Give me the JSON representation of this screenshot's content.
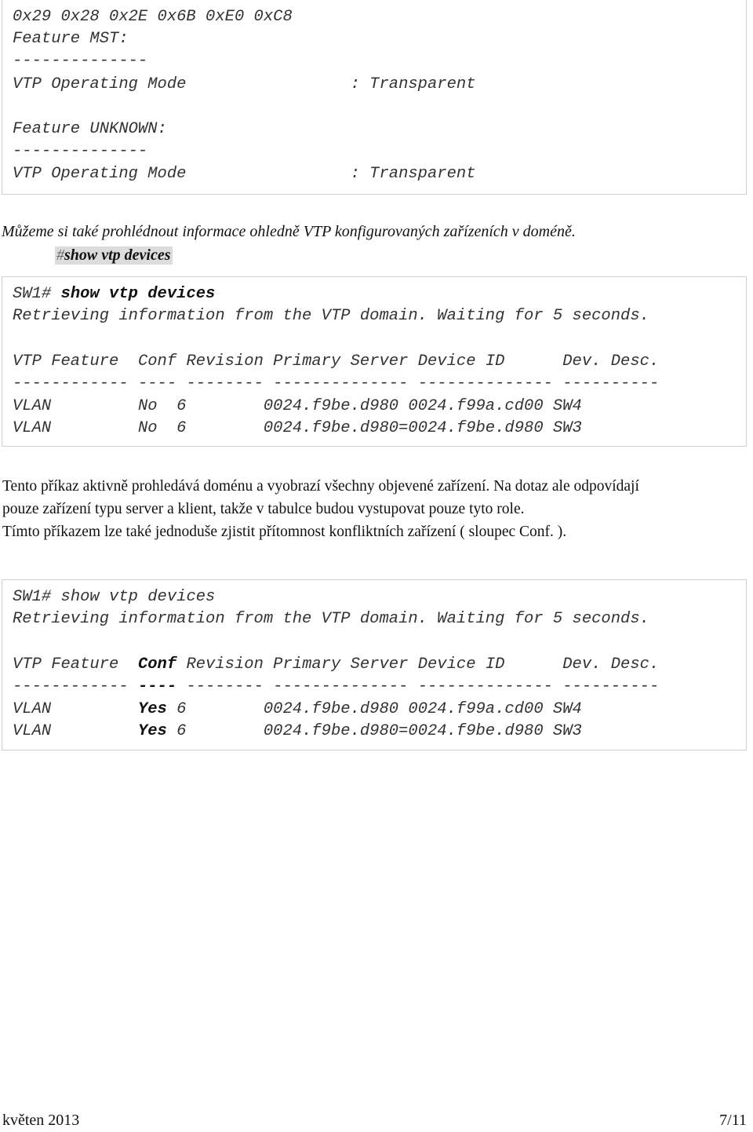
{
  "box1": {
    "lines": [
      "0x29 0x28 0x2E 0x6B 0xE0 0xC8",
      "Feature MST:",
      "--------------",
      "VTP Operating Mode                 : Transparent",
      "",
      "Feature UNKNOWN:",
      "--------------",
      "VTP Operating Mode                 : Transparent"
    ]
  },
  "intro_text": "Můžeme si také prohlédnout informace ohledně VTP konfigurovaných zařízeních v doméně.",
  "command": {
    "hash": "#",
    "text": "show vtp devices"
  },
  "box2": {
    "prompt": "SW1# ",
    "command": "show vtp devices",
    "retrieving": "Retrieving information from the VTP domain. Waiting for 5 seconds.",
    "header": {
      "feature": "VTP Feature  ",
      "conf": "Conf",
      "rest": " Revision Primary Server Device ID      Dev. Desc."
    },
    "separator": {
      "a": "------------ ",
      "b": "----",
      "c": " -------- -------------- -------------- ----------"
    },
    "rows": [
      {
        "feature": "VLAN         ",
        "conf": "No ",
        "rest": " 6        0024.f9be.d980 0024.f99a.cd00 SW4"
      },
      {
        "feature": "VLAN         ",
        "conf": "No ",
        "rest": " 6        0024.f9be.d980=0024.f9be.d980 SW3"
      }
    ]
  },
  "paragraph": [
    "Tento příkaz aktivně prohledává doménu a vyobrazí všechny objevené zařízení. Na dotaz ale odpovídají",
    "pouze zařízení typu server a klient, takže v tabulce budou vystupovat pouze tyto role.",
    "Tímto příkazem lze také jednoduše zjistit přítomnost konfliktních zařízení ( sloupec Conf. )."
  ],
  "box3": {
    "prompt": "SW1# ",
    "command": "show vtp devices",
    "retrieving": "Retrieving information from the VTP domain. Waiting for 5 seconds.",
    "header": {
      "feature": "VTP Feature  ",
      "conf": "Conf",
      "rest": " Revision Primary Server Device ID      Dev. Desc."
    },
    "separator": {
      "a": "------------ ",
      "b": "----",
      "c": " -------- -------------- -------------- ----------"
    },
    "rows": [
      {
        "feature": "VLAN         ",
        "conf": "Yes",
        "rest": " 6        0024.f9be.d980 0024.f99a.cd00 SW4"
      },
      {
        "feature": "VLAN         ",
        "conf": "Yes",
        "rest": " 6        0024.f9be.d980=0024.f9be.d980 SW3"
      }
    ]
  },
  "footer": {
    "date": "květen 2013",
    "page": "7/11"
  }
}
